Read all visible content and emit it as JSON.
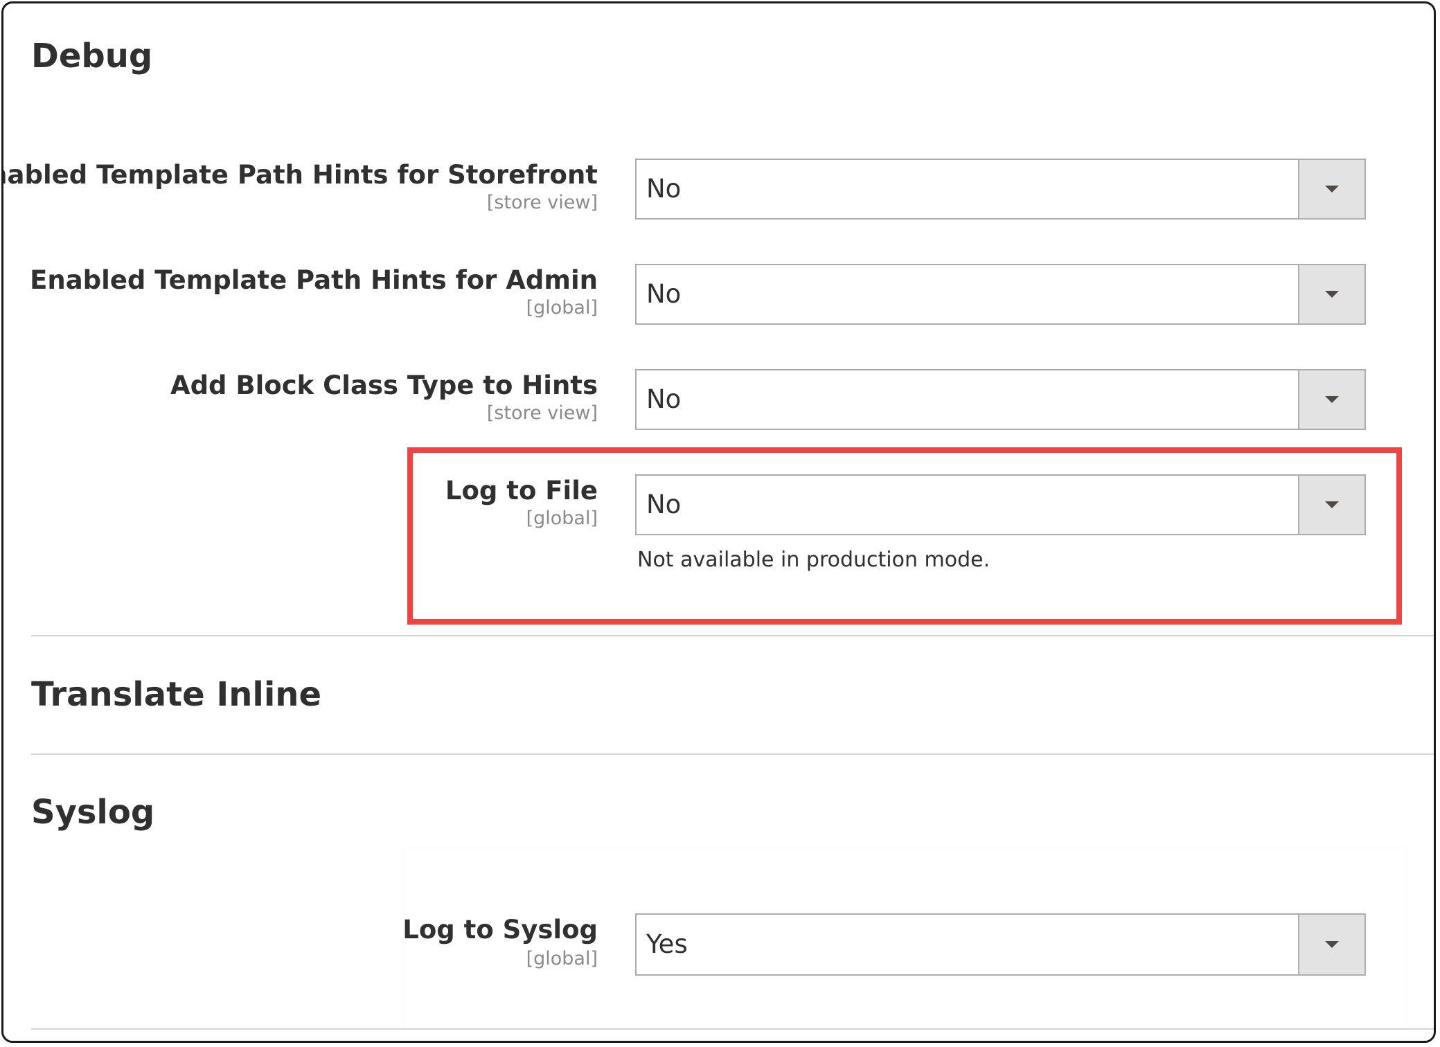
{
  "sections": {
    "debug": {
      "title": "Debug",
      "fields": [
        {
          "label": "Enabled Template Path Hints for Storefront",
          "scope": "[store view]",
          "value": "No"
        },
        {
          "label": "Enabled Template Path Hints for Admin",
          "scope": "[global]",
          "value": "No"
        },
        {
          "label": "Add Block Class Type to Hints",
          "scope": "[store view]",
          "value": "No"
        },
        {
          "label": "Log to File",
          "scope": "[global]",
          "value": "No",
          "note": "Not available in production mode."
        }
      ]
    },
    "translate_inline": {
      "title": "Translate Inline"
    },
    "syslog": {
      "title": "Syslog",
      "fields": [
        {
          "label": "Log to Syslog",
          "scope": "[global]",
          "value": "Yes"
        }
      ]
    }
  },
  "colors": {
    "highlight": "#f04343",
    "dropdown_button": "#e3e3e3",
    "divider": "#d6d6d6"
  },
  "icons": {
    "dropdown": "chevron-down-icon"
  }
}
